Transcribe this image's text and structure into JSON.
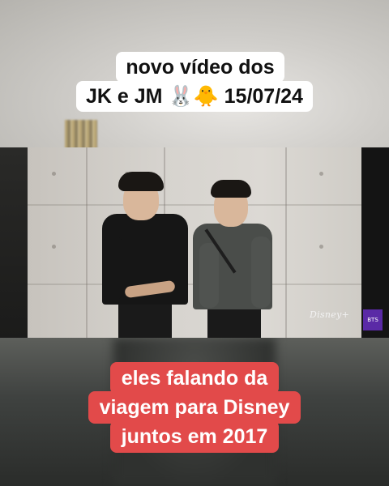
{
  "caption_top": {
    "line1": "novo vídeo dos",
    "line2": "JK e JM 🐰🐥 15/07/24"
  },
  "caption_bottom": {
    "line1": "eles falando da",
    "line2": "viagem para Disney",
    "line3": "juntos em 2017"
  },
  "video": {
    "watermark": "Disney+",
    "badge": "BTS"
  },
  "colors": {
    "caption_top_bg": "#ffffff",
    "caption_bottom_bg": "#e24a4a",
    "badge_bg": "#5a2aa6"
  }
}
